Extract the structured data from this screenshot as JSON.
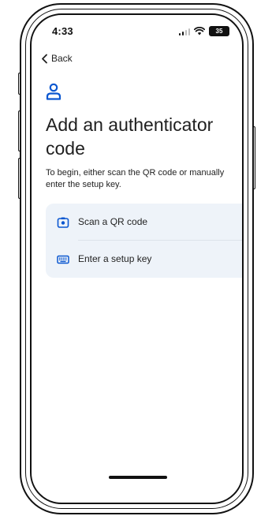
{
  "status_bar": {
    "time": "4:33",
    "battery": "35"
  },
  "nav": {
    "back_label": "Back"
  },
  "page": {
    "title": "Add an authenticator code",
    "description": "To begin, either scan the QR code or manually enter the setup key."
  },
  "options": [
    {
      "label": "Scan a QR code",
      "icon": "camera-icon"
    },
    {
      "label": "Enter a setup key",
      "icon": "keyboard-icon"
    }
  ],
  "colors": {
    "accent": "#0b57d0",
    "card_bg": "#eef3f9",
    "text": "#1f1f1f"
  }
}
